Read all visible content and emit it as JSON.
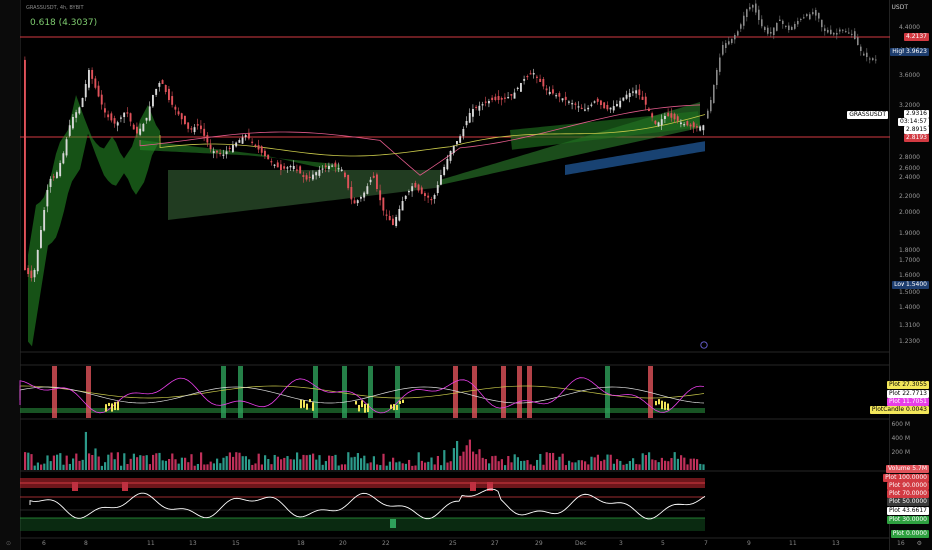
{
  "symbol_title": "GRASSUSDT, 4h, BYBIT",
  "fib_label": "0.618 (4.3037)",
  "currency": "USDT",
  "colors": {
    "up": "#d8d8d8",
    "down": "#e0525a",
    "upFill": "#2c9a6a",
    "bg": "#000000",
    "hline": "#d23a42"
  },
  "price_axis": {
    "ticks": [
      "4.4000",
      "4.0000",
      "3.6000",
      "3.2000",
      "2.8000",
      "2.6000",
      "2.4000",
      "2.2000",
      "2.0000",
      "1.9000",
      "1.8000",
      "1.7000",
      "1.6000",
      "1.5000",
      "1.4000",
      "1.3100",
      "1.2300"
    ],
    "labels": {
      "fib": "4.2137",
      "high_tag": "High",
      "high": "3.9623",
      "ticker": "GRASSUSDT",
      "last": "2.9316",
      "countdown": "03:14:57",
      "p1": "2.8915",
      "p2": "2.8193",
      "low_tag": "Low",
      "low": "1.5400"
    }
  },
  "osc_labels": [
    {
      "name": "Plot",
      "value": "27.3055"
    },
    {
      "name": "Plot",
      "value": "22.7713"
    },
    {
      "name": "Plot",
      "value": "11.7051"
    },
    {
      "name": "PlotCandle",
      "value": "0.0043"
    }
  ],
  "vol_labels": {
    "ticks": [
      "600 M",
      "400 M",
      "200 M"
    ],
    "name": "Volume",
    "value": "5.7M"
  },
  "rsi_labels": [
    {
      "name": "Plot",
      "value": "100.0000"
    },
    {
      "name": "Plot",
      "value": "90.0000"
    },
    {
      "name": "Plot",
      "value": "70.0000"
    },
    {
      "name": "Plot",
      "value": "50.0000"
    },
    {
      "name": "Plot",
      "value": "43.6617"
    },
    {
      "name": "Plot",
      "value": "30.0000"
    },
    {
      "name": "Plot",
      "value": "0.0000"
    }
  ],
  "time_axis": [
    "6",
    "8",
    "11",
    "13",
    "15",
    "18",
    "20",
    "22",
    "25",
    "27",
    "29",
    "Dec",
    "3",
    "5",
    "7",
    "9",
    "11",
    "13",
    "16"
  ]
}
